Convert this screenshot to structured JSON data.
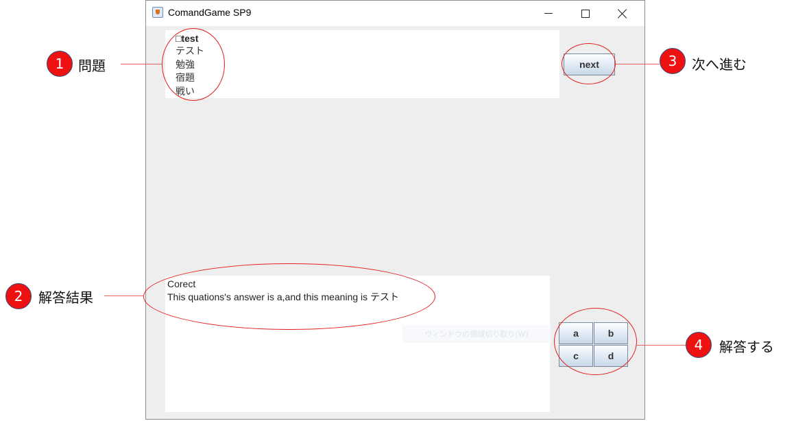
{
  "window": {
    "title": "ComandGame SP9"
  },
  "question_panel": {
    "lines": [
      "□test",
      "テスト",
      "勉強",
      "宿題",
      "戦い"
    ]
  },
  "next_button": {
    "label": "next"
  },
  "answer_panel": {
    "result": "Corect",
    "explanation": "This quations's answer is a,and this meaning is テスト",
    "ghost_text": "ウィンドウの領域切り取り(W)"
  },
  "choices": [
    {
      "label": "a"
    },
    {
      "label": "b"
    },
    {
      "label": "c"
    },
    {
      "label": "d"
    }
  ],
  "annotations": [
    {
      "number": "1",
      "label": "問題"
    },
    {
      "number": "2",
      "label": "解答結果"
    },
    {
      "number": "3",
      "label": "次へ進む"
    },
    {
      "number": "4",
      "label": "解答する"
    }
  ],
  "colors": {
    "annotation_red": "#ee1111",
    "window_background": "#eeeeee"
  }
}
